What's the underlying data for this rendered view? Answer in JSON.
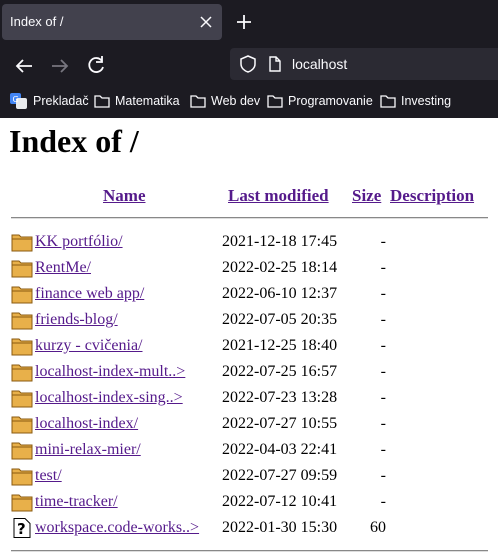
{
  "browser": {
    "tab_title": "Index of /",
    "url": "localhost",
    "bookmarks": [
      "Prekladač",
      "Matematika",
      "Web dev",
      "Programovanie",
      "Investing"
    ]
  },
  "page": {
    "title": "Index of /",
    "columns": [
      "Name",
      "Last modified",
      "Size",
      "Description"
    ],
    "rows": [
      {
        "name": "KK portfólio/",
        "modified": "2021-12-18 17:45",
        "size": "-",
        "icon": "folder-icon"
      },
      {
        "name": "RentMe/",
        "modified": "2022-02-25 18:14",
        "size": "-",
        "icon": "folder-icon"
      },
      {
        "name": "finance web app/",
        "modified": "2022-06-10 12:37",
        "size": "-",
        "icon": "folder-icon"
      },
      {
        "name": "friends-blog/",
        "modified": "2022-07-05 20:35",
        "size": "-",
        "icon": "folder-icon"
      },
      {
        "name": "kurzy - cvičenia/",
        "modified": "2021-12-25 18:40",
        "size": "-",
        "icon": "folder-icon"
      },
      {
        "name": "localhost-index-mult..>",
        "modified": "2022-07-25 16:57",
        "size": "-",
        "icon": "folder-icon"
      },
      {
        "name": "localhost-index-sing..>",
        "modified": "2022-07-23 13:28",
        "size": "-",
        "icon": "folder-icon"
      },
      {
        "name": "localhost-index/",
        "modified": "2022-07-27 10:55",
        "size": "-",
        "icon": "folder-icon"
      },
      {
        "name": "mini-relax-mier/",
        "modified": "2022-04-03 22:41",
        "size": "-",
        "icon": "folder-icon"
      },
      {
        "name": "test/",
        "modified": "2022-07-27 09:59",
        "size": "-",
        "icon": "folder-icon"
      },
      {
        "name": "time-tracker/",
        "modified": "2022-07-12 10:41",
        "size": "-",
        "icon": "folder-icon"
      },
      {
        "name": "workspace.code-works..>",
        "modified": "2022-01-30 15:30",
        "size": "60",
        "icon": "unknown-file-icon"
      }
    ]
  }
}
